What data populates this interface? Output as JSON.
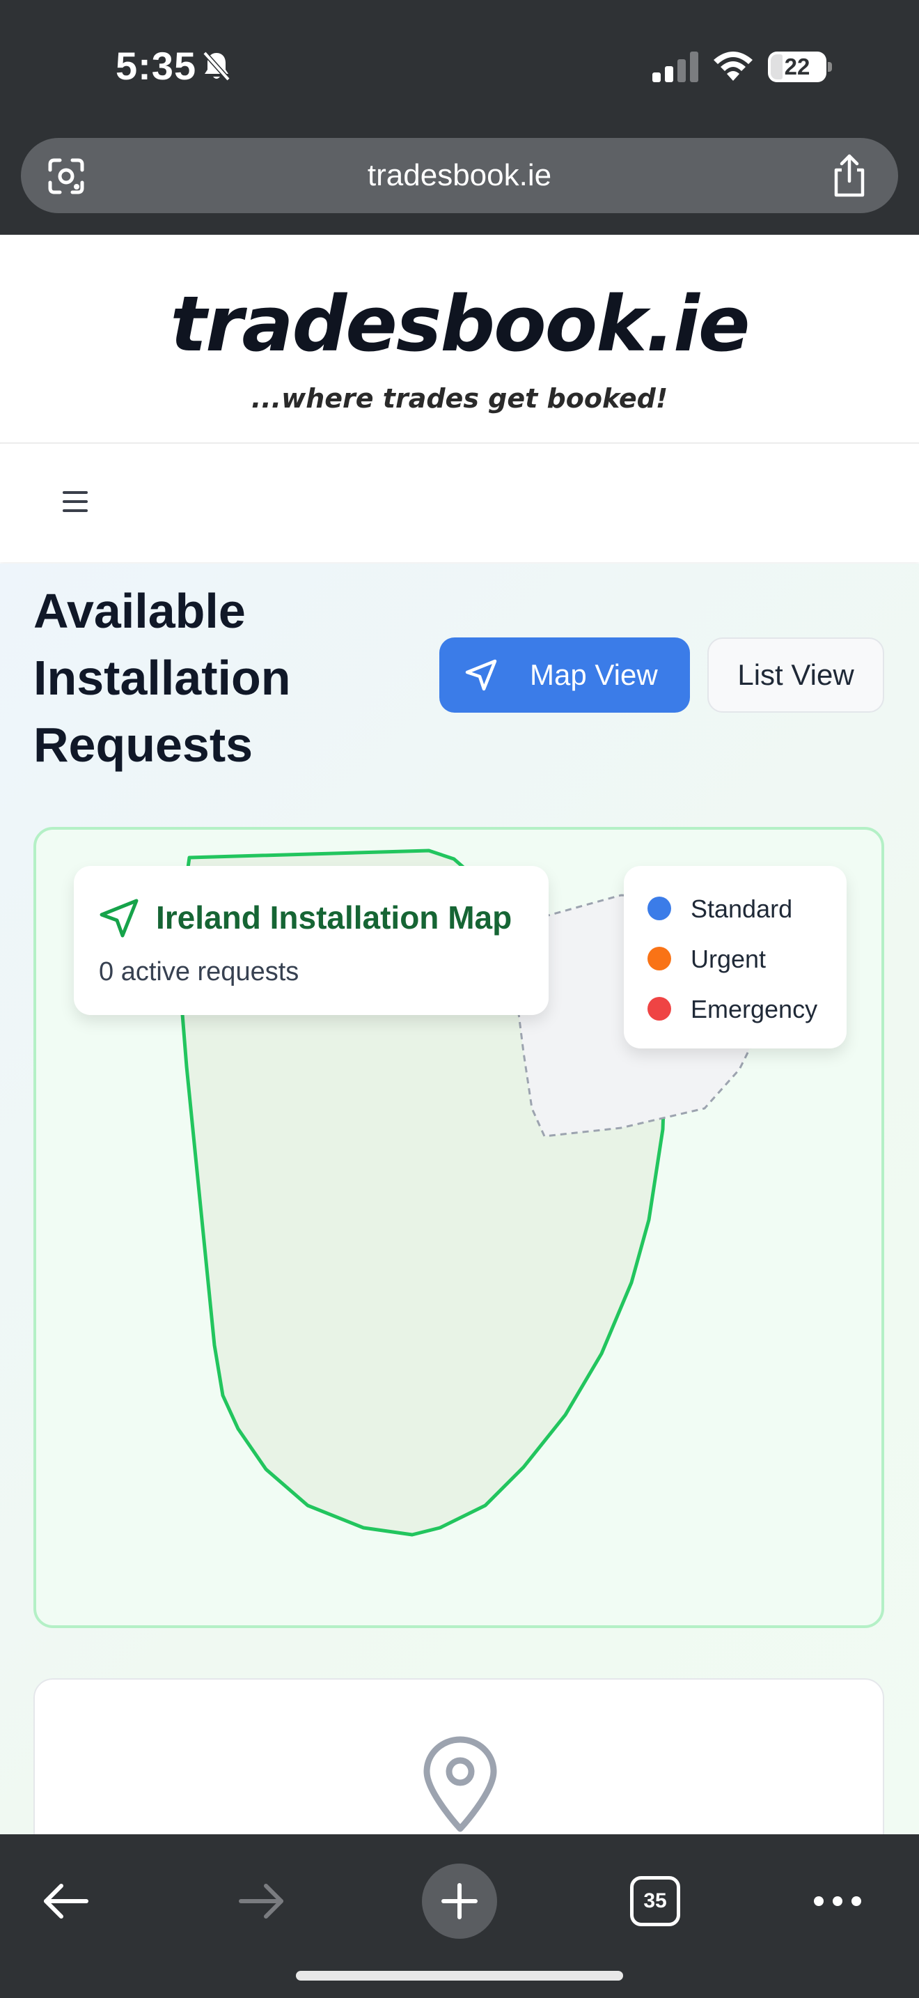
{
  "status_bar": {
    "time": "5:35",
    "battery": "22"
  },
  "browser": {
    "url": "tradesbook.ie",
    "tab_count": "35"
  },
  "site": {
    "logo": "tradesbook.ie",
    "tagline": "...where trades get booked!"
  },
  "page": {
    "title": "Available Installation Requests",
    "view_toggle": {
      "map_label": "Map View",
      "list_label": "List View",
      "active": "Map View"
    }
  },
  "map": {
    "title": "Ireland Installation Map",
    "subtitle": "0 active requests",
    "legend": [
      {
        "label": "Standard",
        "color": "#3b7ce8"
      },
      {
        "label": "Urgent",
        "color": "#f97316"
      },
      {
        "label": "Emergency",
        "color": "#ef4444"
      }
    ],
    "colors": {
      "border": "#b4f0c6",
      "ireland_stroke": "#22c55e",
      "accent": "#166534"
    }
  },
  "icons": {
    "bell": "bell-slash-icon",
    "lens": "google-lens-icon",
    "share": "share-icon",
    "menu": "hamburger-icon",
    "navigate": "navigation-arrow-icon",
    "pin": "map-pin-icon",
    "back": "back-arrow-icon",
    "forward": "forward-arrow-icon",
    "new_tab": "plus-icon",
    "tabs": "tab-count-icon",
    "more": "more-icon"
  }
}
